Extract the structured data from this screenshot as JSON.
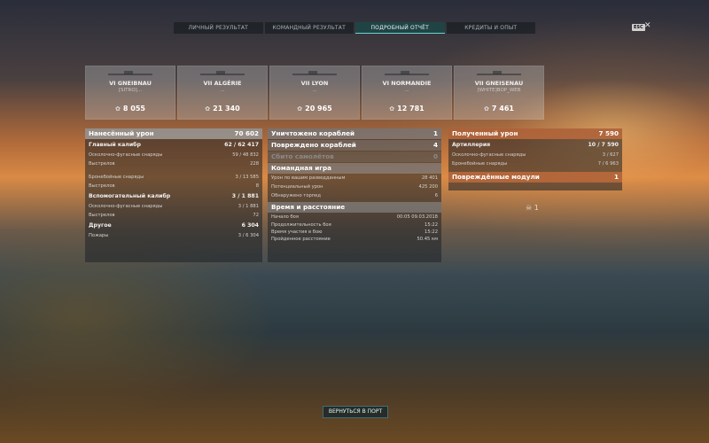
{
  "tabs": [
    "ЛИЧНЫЙ РЕЗУЛЬТАТ",
    "КОМАНДНЫЙ РЕЗУЛЬТАТ",
    "ПОДРОБНЫЙ ОТЧЁТ",
    "КРЕДИТЫ И ОПЫТ"
  ],
  "esc_label": "ESC",
  "close_glyph": "✕",
  "ships": [
    {
      "name": "VI GNEIBNAU",
      "player": "[SITRO]...",
      "score": "8 055"
    },
    {
      "name": "VII ALGÉRIE",
      "player": "...",
      "score": "21 340"
    },
    {
      "name": "VII LYON",
      "player": "...",
      "score": "20 965"
    },
    {
      "name": "VI NORMANDIE",
      "player": "...",
      "score": "12 781"
    },
    {
      "name": "VII GNEISENAU",
      "player": "[WHITE]BOP_WEB",
      "score": "7 461"
    }
  ],
  "damage": {
    "title": "Нанесённый урон",
    "total": "70 602",
    "main": {
      "label": "Главный калибр",
      "value": "62 / 62 417"
    },
    "he_label": "Осколочно-фугасные снаряды",
    "he_value": "59 / 48 832",
    "shots_label": "Выстрелов",
    "he_shots": "228",
    "ap_label": "Бронебойные снаряды",
    "ap_value": "3 / 13 585",
    "ap_shots": "8",
    "sec": {
      "label": "Вспомогательный калибр",
      "value": "3 / 1 881"
    },
    "sec_he_value": "3 / 1 881",
    "sec_shots": "72",
    "other": {
      "label": "Другое",
      "value": "6 304"
    },
    "fires_label": "Пожары",
    "fires_value": "3 / 6 304"
  },
  "kills": {
    "destroyed_label": "Уничтожено кораблей",
    "destroyed": "1",
    "damaged_label": "Повреждено кораблей",
    "damaged": "4",
    "planes_label": "Сбито самолётов",
    "planes": "0",
    "team_title": "Командная игра",
    "spotting_label": "Урон по вашим разведданным",
    "spotting": "28 401",
    "potential_label": "Потенциальный урон",
    "potential": "425 200",
    "torps_label": "Обнаружено торпед",
    "torps": "6",
    "time_title": "Время и расстояние",
    "start_label": "Начало боя",
    "start": "00:05  09.03.2018",
    "duration_label": "Продолжительность боя",
    "duration": "15:22",
    "participation_label": "Время участия в бою",
    "participation": "15:22",
    "distance_label": "Пройденное расстояние",
    "distance": "50.45 км"
  },
  "received": {
    "title": "Полученный урон",
    "total": "7 590",
    "art_label": "Артиллерия",
    "art_value": "10 / 7 590",
    "he_label": "Осколочно-фугасные снаряды",
    "he_value": "3 / 627",
    "ap_label": "Бронебойные снаряды",
    "ap_value": "7 / 6 963",
    "modules_title": "Повреждённые модули",
    "modules": "1",
    "skull_count": "1"
  },
  "return_button": "ВЕРНУТЬСЯ В ПОРТ"
}
